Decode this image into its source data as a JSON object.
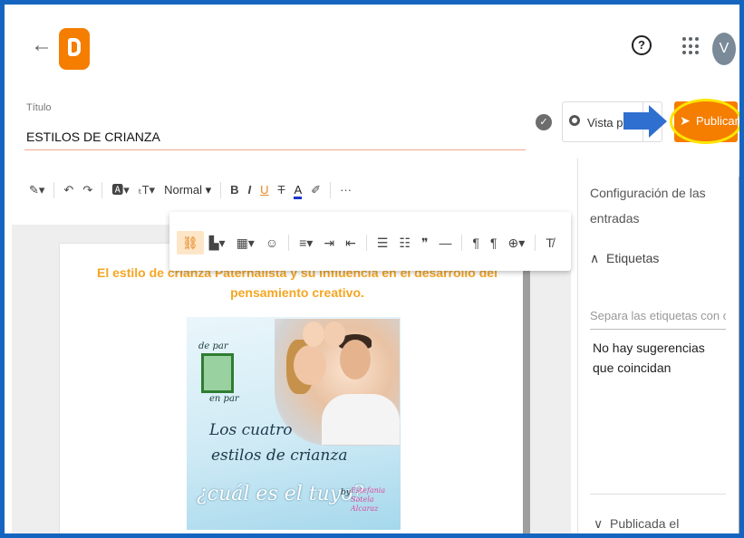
{
  "topbar": {
    "back_icon": "←",
    "help_icon": "?",
    "avatar_letter": "V"
  },
  "post": {
    "title_label": "Título",
    "title_value": "ESTILOS DE CRIANZA",
    "preview_label": "Vista pre",
    "publish_label": "Publicar"
  },
  "toolbar": {
    "style_value": "Normal",
    "items": [
      "pen-icon",
      "undo-icon",
      "redo-icon",
      "font-icon",
      "font-size-icon",
      "bold",
      "italic",
      "underline",
      "strikethrough",
      "text-color",
      "highlight",
      "more"
    ]
  },
  "toolbar_labels": {
    "bold": "B",
    "italic": "I",
    "underline": "U",
    "strike": "T",
    "textcolor": "A",
    "more": "···"
  },
  "document": {
    "heading": "El estilo de crianza Paternalista y su influencia en el desarrollo del pensamiento creativo.",
    "image_text": {
      "top_left_1": "de par",
      "top_left_2": "en par",
      "line1": "Los cuatro",
      "line2": "estilos de crianza",
      "line3": "¿cuál es el tuyo?",
      "by": "by",
      "author": "Estefania Sotela Alcaraz"
    }
  },
  "sidebar": {
    "section_title": "Configuración de las entradas",
    "tags_label": "Etiquetas",
    "tags_placeholder": "Separa las etiquetas con c...",
    "no_suggestions": "No hay sugerencias que coincidan",
    "published_label": "Publicada el"
  },
  "colors": {
    "accent": "#f57d00",
    "frame": "#1565c0",
    "highlight_ring": "#ffe500",
    "arrow": "#2f6fd0",
    "heading_text": "#f5a623"
  }
}
